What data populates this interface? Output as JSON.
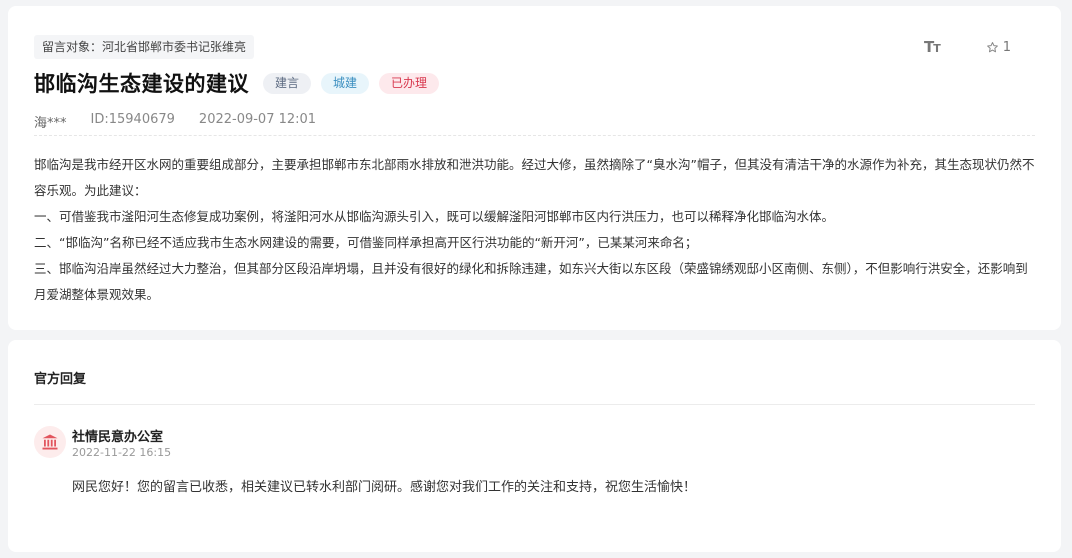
{
  "message": {
    "target": "留言对象：河北省邯郸市委书记张维亮",
    "title": "邯临沟生态建设的建议",
    "tags": {
      "type": "建言",
      "field": "城建",
      "status": "已办理"
    },
    "author": "海***",
    "id": "ID:15940679",
    "time": "2022-09-07 12:01",
    "favorite_count": "1",
    "paragraphs": [
      "邯临沟是我市经开区水网的重要组成部分，主要承担邯郸市东北部雨水排放和泄洪功能。经过大修，虽然摘除了“臭水沟”帽子，但其没有清洁干净的水源作为补充，其生态现状仍然不容乐观。为此建议：",
      "一、可借鉴我市滏阳河生态修复成功案例，将滏阳河水从邯临沟源头引入，既可以缓解滏阳河邯郸市区内行洪压力，也可以稀释净化邯临沟水体。",
      "二、“邯临沟”名称已经不适应我市生态水网建设的需要，可借鉴同样承担高开区行洪功能的“新开河”，已某某河来命名；",
      "三、邯临沟沿岸虽然经过大力整治，但其部分区段沿岸坍塌，且并没有很好的绿化和拆除违建，如东兴大街以东区段（荣盛锦绣观邸小区南侧、东侧），不但影响行洪安全，还影响到月爱湖整体景观效果。"
    ]
  },
  "reply": {
    "heading": "官方回复",
    "org": "社情民意办公室",
    "time": "2022-11-22 16:15",
    "text": "网民您好！您的留言已收悉，相关建议已转水利部门阅研。感谢您对我们工作的关注和支持，祝您生活愉快！"
  },
  "icons": {
    "font_size": "font-size-icon",
    "favorite": "star-icon",
    "org": "government-building-icon"
  },
  "colors": {
    "status_red": "#d8394f",
    "field_blue": "#3b8fc0",
    "org_icon": "#e2555e"
  }
}
